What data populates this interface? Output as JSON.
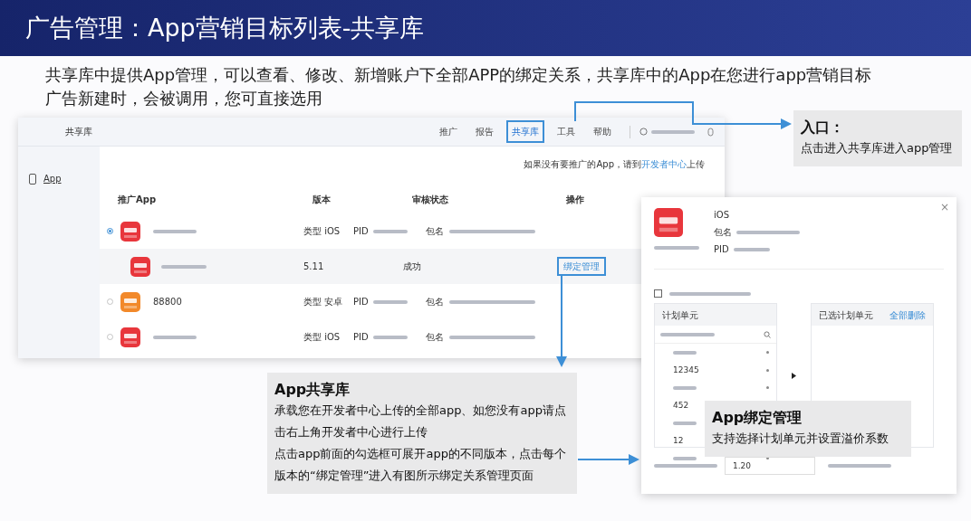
{
  "slide_title": "广告管理：App营销目标列表-共享库",
  "intro": "共享库中提供App管理，可以查看、修改、新增账户下全部APP的绑定关系，共享库中的App在您进行app营销目标广告新建时，会被调用，您可直接选用",
  "screen": {
    "page_title": "共享库",
    "nav": [
      {
        "label": "推广",
        "selected": false,
        "highlighted": false
      },
      {
        "label": "报告",
        "selected": false,
        "highlighted": false
      },
      {
        "label": "共享库",
        "selected": true,
        "highlighted": true
      },
      {
        "label": "工具",
        "selected": false,
        "highlighted": false
      },
      {
        "label": "帮助",
        "selected": false,
        "highlighted": false
      }
    ],
    "sidebar": [
      {
        "label": "App",
        "selected": true
      }
    ],
    "hint": {
      "before": "如果没有要推广的App，请到",
      "link": "开发者中心",
      "after": "上传"
    },
    "table": {
      "columns": [
        "推广App",
        "版本",
        "审核状态",
        "操作"
      ],
      "rows": [
        {
          "kind": "app",
          "expanded": true,
          "color": "#e8363c",
          "type_label": "类型",
          "type": "iOS",
          "pid_label": "PID",
          "pkg_label": "包名"
        },
        {
          "kind": "version",
          "color": "#e8363c",
          "version": "5.11",
          "status": "成功",
          "action": {
            "label": "绑定管理",
            "highlighted": true
          }
        },
        {
          "kind": "app",
          "expanded": false,
          "color": "#f2892a",
          "name": "88800",
          "type_label": "类型",
          "type": "安卓",
          "pid_label": "PID",
          "pkg_label": "包名"
        },
        {
          "kind": "app",
          "expanded": false,
          "color": "#e8363c",
          "type_label": "类型",
          "type": "iOS",
          "pid_label": "PID",
          "pkg_label": "包名"
        }
      ]
    }
  },
  "modal": {
    "close": "×",
    "color": "#e8363c",
    "platform": "iOS",
    "pkg_label": "包名",
    "pid_label": "PID",
    "checked": false,
    "left_title": "计划单元",
    "units": [
      {
        "kind": "blurred"
      },
      {
        "kind": "text",
        "text": "12345"
      },
      {
        "kind": "blurred"
      },
      {
        "kind": "text",
        "text": "452"
      },
      {
        "kind": "blurred"
      },
      {
        "kind": "text",
        "text": "12"
      },
      {
        "kind": "blurred"
      }
    ],
    "right_title": "已选计划单元",
    "clear": "全部删除",
    "coef": "1.20"
  },
  "callouts": [
    {
      "title": "入口：",
      "lines": [
        "点击进入共享库进入app管理"
      ]
    },
    {
      "title": "App共享库",
      "lines": [
        "承载您在开发者中心上传的全部app、如您没有app请点击右上角开发者中心进行上传",
        "点击app前面的勾选框可展开app的不同版本，点击每个版本的“绑定管理”进入有图所示绑定关系管理页面"
      ]
    },
    {
      "title": "App绑定管理",
      "lines": [
        "支持选择计划单元并设置溢价系数"
      ]
    }
  ]
}
